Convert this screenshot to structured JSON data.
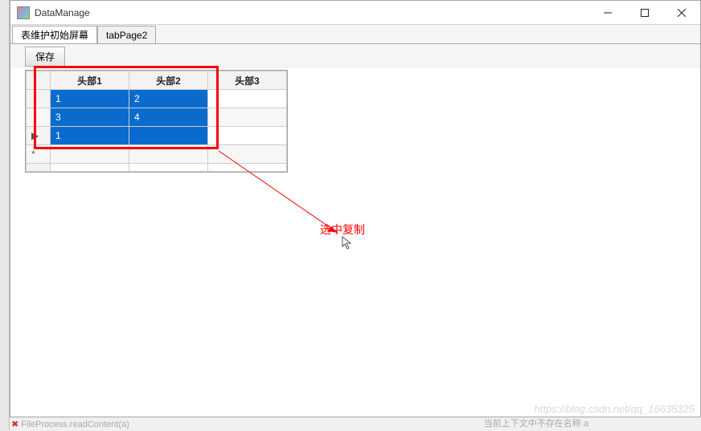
{
  "window": {
    "title": "DataManage"
  },
  "tabs": [
    {
      "label": "表维护初始屏幕",
      "active": true
    },
    {
      "label": "tabPage2",
      "active": false
    }
  ],
  "toolbar": {
    "save_label": "保存"
  },
  "grid": {
    "headers": [
      "头部1",
      "头部2",
      "头部3"
    ],
    "rows": [
      {
        "marker": "",
        "cells": [
          {
            "v": "1",
            "sel": true
          },
          {
            "v": "2",
            "sel": true
          },
          {
            "v": "",
            "sel": false
          }
        ]
      },
      {
        "marker": "",
        "cells": [
          {
            "v": "3",
            "sel": true
          },
          {
            "v": "4",
            "sel": true
          },
          {
            "v": "",
            "sel": false
          }
        ]
      },
      {
        "marker": "▶",
        "cells": [
          {
            "v": "1",
            "sel": true
          },
          {
            "v": "",
            "sel": true
          },
          {
            "v": "",
            "sel": false
          }
        ]
      },
      {
        "marker": "*",
        "cells": [
          {
            "v": "",
            "sel": false
          },
          {
            "v": "",
            "sel": false
          },
          {
            "v": "",
            "sel": false
          }
        ]
      }
    ]
  },
  "annotation": {
    "label": "选中复制"
  },
  "watermark": "https://blog.csdn.net/qq_16635325",
  "footer": {
    "left": "FileProcess.readContent(a)",
    "right": "当前上下文中不存在名称 a"
  }
}
